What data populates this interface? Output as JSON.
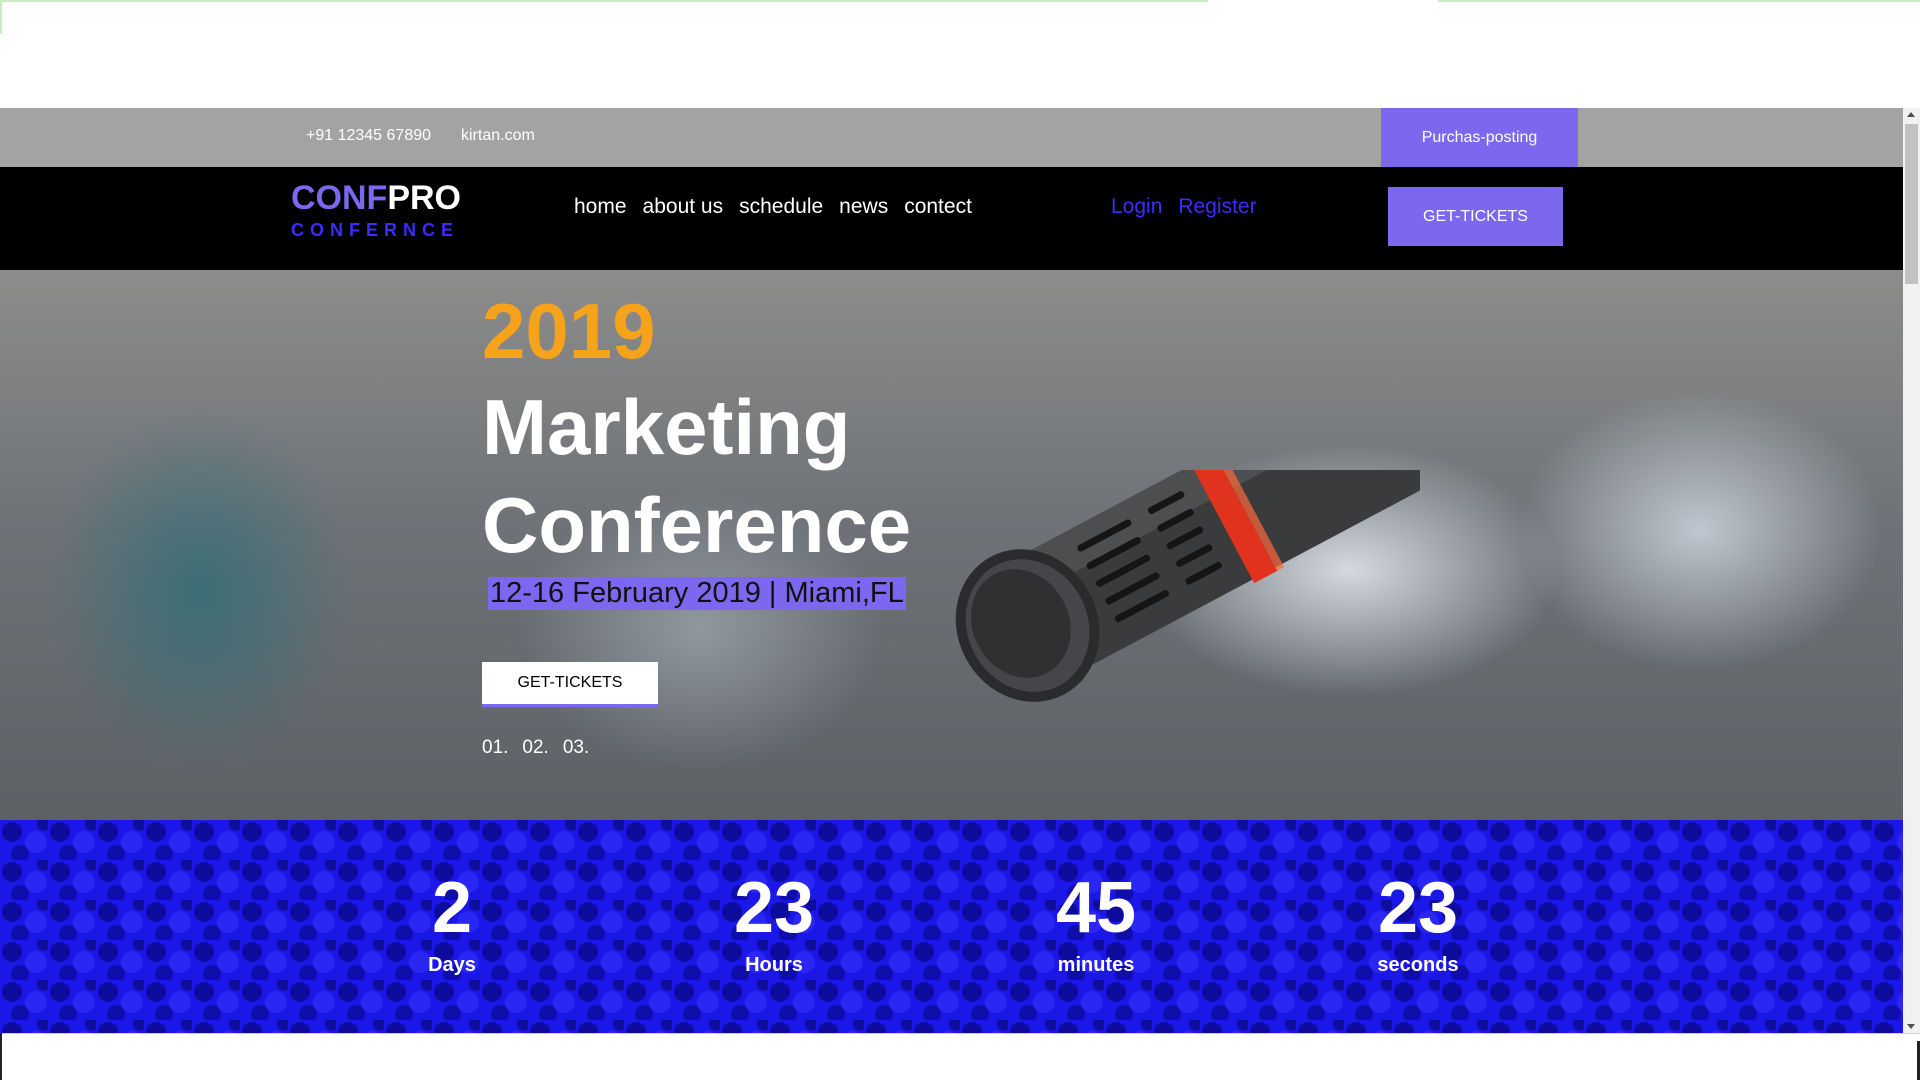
{
  "infobar": {
    "phone": "+91 12345 67890",
    "site": "kirtan.com",
    "purchase_label": "Purchas-posting"
  },
  "nav": {
    "logo_conf": "CONF",
    "logo_pro": "PRO",
    "logo_sub": "CONFERNCE",
    "links": [
      "home",
      "about us",
      "schedule",
      "news",
      "contect"
    ],
    "login": "Login",
    "register": "Register",
    "ticket_label": "GET-TICKETS"
  },
  "hero": {
    "year": "2019",
    "title_line1": "Marketing",
    "title_line2": "Conference",
    "date": "12-16 February 2019 | Miami,FL",
    "ticket_label": "GET-TICKETS",
    "slides": [
      "01.",
      "02.",
      "03."
    ]
  },
  "countdown": {
    "days": {
      "value": "2",
      "label": "Days"
    },
    "hours": {
      "value": "23",
      "label": "Hours"
    },
    "minutes": {
      "value": "45",
      "label": "minutes"
    },
    "seconds": {
      "value": "23",
      "label": "seconds"
    }
  },
  "colors": {
    "accent": "#7b68ee",
    "deep_blue": "#3b2cff",
    "year_orange": "#f6a21b",
    "countdown_bg": "#1b17e8",
    "infobar_bg": "#a3a3a3"
  }
}
